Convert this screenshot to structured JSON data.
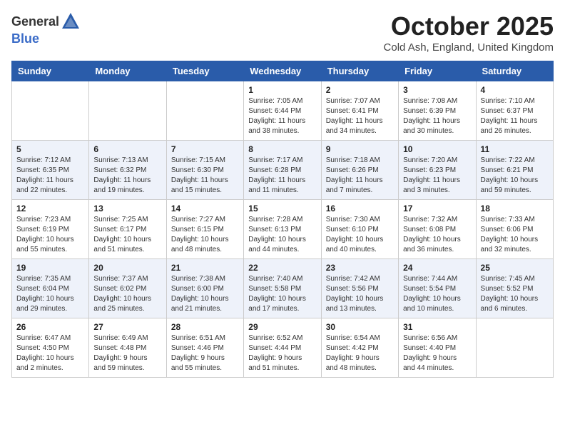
{
  "header": {
    "logo_general": "General",
    "logo_blue": "Blue",
    "month": "October 2025",
    "location": "Cold Ash, England, United Kingdom"
  },
  "weekdays": [
    "Sunday",
    "Monday",
    "Tuesday",
    "Wednesday",
    "Thursday",
    "Friday",
    "Saturday"
  ],
  "weeks": [
    [
      {
        "day": "",
        "info": ""
      },
      {
        "day": "",
        "info": ""
      },
      {
        "day": "",
        "info": ""
      },
      {
        "day": "1",
        "info": "Sunrise: 7:05 AM\nSunset: 6:44 PM\nDaylight: 11 hours\nand 38 minutes."
      },
      {
        "day": "2",
        "info": "Sunrise: 7:07 AM\nSunset: 6:41 PM\nDaylight: 11 hours\nand 34 minutes."
      },
      {
        "day": "3",
        "info": "Sunrise: 7:08 AM\nSunset: 6:39 PM\nDaylight: 11 hours\nand 30 minutes."
      },
      {
        "day": "4",
        "info": "Sunrise: 7:10 AM\nSunset: 6:37 PM\nDaylight: 11 hours\nand 26 minutes."
      }
    ],
    [
      {
        "day": "5",
        "info": "Sunrise: 7:12 AM\nSunset: 6:35 PM\nDaylight: 11 hours\nand 22 minutes."
      },
      {
        "day": "6",
        "info": "Sunrise: 7:13 AM\nSunset: 6:32 PM\nDaylight: 11 hours\nand 19 minutes."
      },
      {
        "day": "7",
        "info": "Sunrise: 7:15 AM\nSunset: 6:30 PM\nDaylight: 11 hours\nand 15 minutes."
      },
      {
        "day": "8",
        "info": "Sunrise: 7:17 AM\nSunset: 6:28 PM\nDaylight: 11 hours\nand 11 minutes."
      },
      {
        "day": "9",
        "info": "Sunrise: 7:18 AM\nSunset: 6:26 PM\nDaylight: 11 hours\nand 7 minutes."
      },
      {
        "day": "10",
        "info": "Sunrise: 7:20 AM\nSunset: 6:23 PM\nDaylight: 11 hours\nand 3 minutes."
      },
      {
        "day": "11",
        "info": "Sunrise: 7:22 AM\nSunset: 6:21 PM\nDaylight: 10 hours\nand 59 minutes."
      }
    ],
    [
      {
        "day": "12",
        "info": "Sunrise: 7:23 AM\nSunset: 6:19 PM\nDaylight: 10 hours\nand 55 minutes."
      },
      {
        "day": "13",
        "info": "Sunrise: 7:25 AM\nSunset: 6:17 PM\nDaylight: 10 hours\nand 51 minutes."
      },
      {
        "day": "14",
        "info": "Sunrise: 7:27 AM\nSunset: 6:15 PM\nDaylight: 10 hours\nand 48 minutes."
      },
      {
        "day": "15",
        "info": "Sunrise: 7:28 AM\nSunset: 6:13 PM\nDaylight: 10 hours\nand 44 minutes."
      },
      {
        "day": "16",
        "info": "Sunrise: 7:30 AM\nSunset: 6:10 PM\nDaylight: 10 hours\nand 40 minutes."
      },
      {
        "day": "17",
        "info": "Sunrise: 7:32 AM\nSunset: 6:08 PM\nDaylight: 10 hours\nand 36 minutes."
      },
      {
        "day": "18",
        "info": "Sunrise: 7:33 AM\nSunset: 6:06 PM\nDaylight: 10 hours\nand 32 minutes."
      }
    ],
    [
      {
        "day": "19",
        "info": "Sunrise: 7:35 AM\nSunset: 6:04 PM\nDaylight: 10 hours\nand 29 minutes."
      },
      {
        "day": "20",
        "info": "Sunrise: 7:37 AM\nSunset: 6:02 PM\nDaylight: 10 hours\nand 25 minutes."
      },
      {
        "day": "21",
        "info": "Sunrise: 7:38 AM\nSunset: 6:00 PM\nDaylight: 10 hours\nand 21 minutes."
      },
      {
        "day": "22",
        "info": "Sunrise: 7:40 AM\nSunset: 5:58 PM\nDaylight: 10 hours\nand 17 minutes."
      },
      {
        "day": "23",
        "info": "Sunrise: 7:42 AM\nSunset: 5:56 PM\nDaylight: 10 hours\nand 13 minutes."
      },
      {
        "day": "24",
        "info": "Sunrise: 7:44 AM\nSunset: 5:54 PM\nDaylight: 10 hours\nand 10 minutes."
      },
      {
        "day": "25",
        "info": "Sunrise: 7:45 AM\nSunset: 5:52 PM\nDaylight: 10 hours\nand 6 minutes."
      }
    ],
    [
      {
        "day": "26",
        "info": "Sunrise: 6:47 AM\nSunset: 4:50 PM\nDaylight: 10 hours\nand 2 minutes."
      },
      {
        "day": "27",
        "info": "Sunrise: 6:49 AM\nSunset: 4:48 PM\nDaylight: 9 hours\nand 59 minutes."
      },
      {
        "day": "28",
        "info": "Sunrise: 6:51 AM\nSunset: 4:46 PM\nDaylight: 9 hours\nand 55 minutes."
      },
      {
        "day": "29",
        "info": "Sunrise: 6:52 AM\nSunset: 4:44 PM\nDaylight: 9 hours\nand 51 minutes."
      },
      {
        "day": "30",
        "info": "Sunrise: 6:54 AM\nSunset: 4:42 PM\nDaylight: 9 hours\nand 48 minutes."
      },
      {
        "day": "31",
        "info": "Sunrise: 6:56 AM\nSunset: 4:40 PM\nDaylight: 9 hours\nand 44 minutes."
      },
      {
        "day": "",
        "info": ""
      }
    ]
  ]
}
